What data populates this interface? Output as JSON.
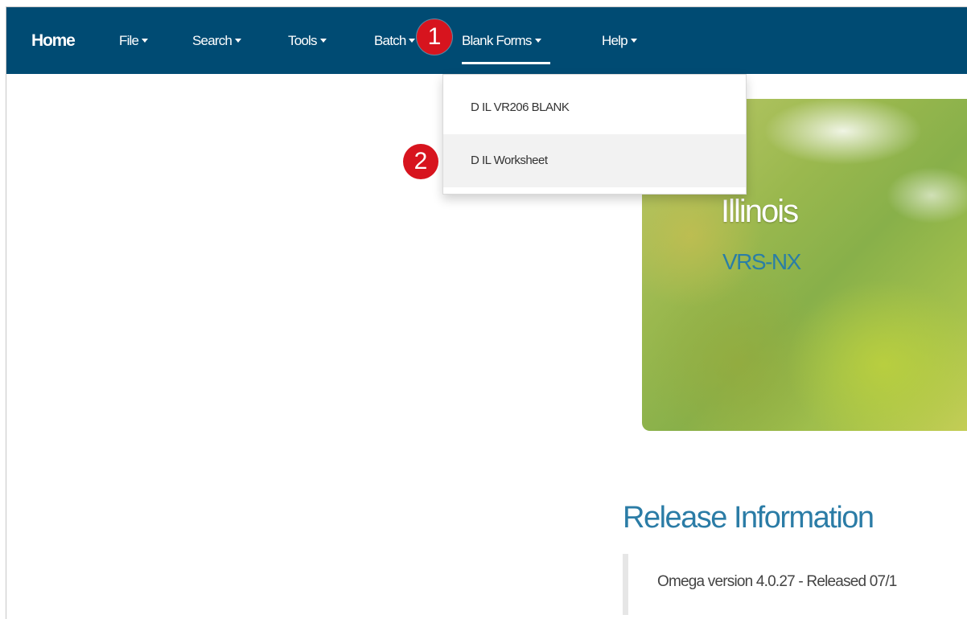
{
  "navbar": {
    "items": [
      {
        "label": "Home",
        "has_caret": false
      },
      {
        "label": "File",
        "has_caret": true
      },
      {
        "label": "Search",
        "has_caret": true
      },
      {
        "label": "Tools",
        "has_caret": true
      },
      {
        "label": "Batch",
        "has_caret": true
      },
      {
        "label": "Blank Forms",
        "has_caret": true,
        "active": true
      },
      {
        "label": "Help",
        "has_caret": true
      }
    ]
  },
  "annotations": {
    "step1": "1",
    "step2": "2"
  },
  "dropdown": {
    "items": [
      {
        "label": "D IL VR206 BLANK"
      },
      {
        "label": "D IL Worksheet",
        "highlighted": true
      }
    ]
  },
  "hero": {
    "title": "Illinois",
    "subtitle": "VRS-NX"
  },
  "release": {
    "heading": "Release Information",
    "text": "Omega version 4.0.27 - Released 07/1"
  },
  "colors": {
    "navbar": "#004b73",
    "badge": "#d7141e",
    "accent_text": "#2b7ca6"
  }
}
